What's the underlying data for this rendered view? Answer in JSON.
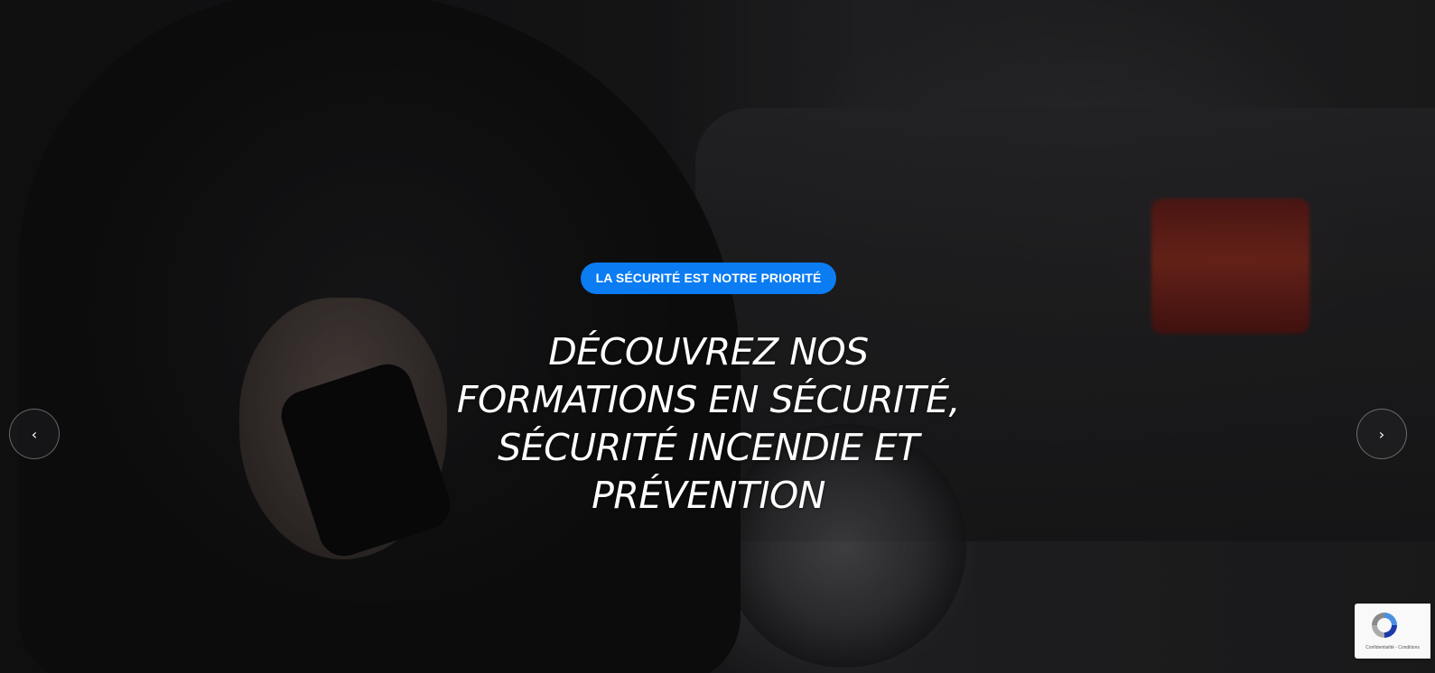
{
  "hero": {
    "badge_label": "LA SÉCURITÉ EST NOTRE PRIORITÉ",
    "headline_lines": [
      "DÉCOUVREZ NOS",
      "FORMATIONS EN SÉCURITÉ,",
      "SÉCURITÉ INCENDIE ET",
      "PRÉVENTION"
    ],
    "background_image": "security agent in dark suit holding a walkie-talkie behind her back, black car in background"
  },
  "slider": {
    "prev_icon": "chevron-left-icon",
    "next_icon": "chevron-right-icon",
    "prev_glyph": "‹",
    "next_glyph": "›"
  },
  "recaptcha": {
    "terms_text": "Confidentialité - Conditions"
  },
  "colors": {
    "badge_bg": "#0b7cf2",
    "headline": "#ffffff",
    "overlay": "rgba(0,0,0,0.28)"
  }
}
